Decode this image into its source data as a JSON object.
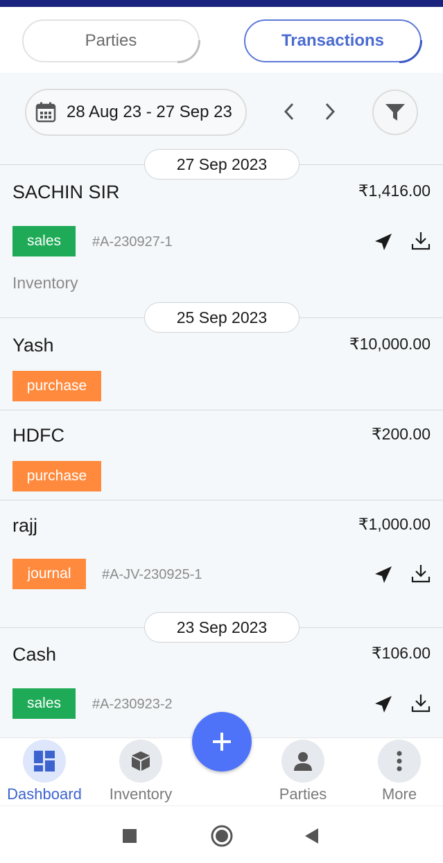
{
  "tabs": {
    "parties": "Parties",
    "transactions": "Transactions"
  },
  "filter": {
    "date_range": "28 Aug 23 - 27 Sep 23"
  },
  "groups": [
    {
      "date": "27 Sep 2023",
      "items": [
        {
          "name": "SACHIN SIR",
          "amount": "₹1,416.00",
          "type": "sales",
          "ref": "#A-230927-1",
          "sub": "Inventory"
        }
      ]
    },
    {
      "date": "25 Sep 2023",
      "items": [
        {
          "name": "Yash",
          "amount": "₹10,000.00",
          "type": "purchase"
        },
        {
          "name": "HDFC",
          "amount": "₹200.00",
          "type": "purchase"
        },
        {
          "name": "rajj",
          "amount": "₹1,000.00",
          "type": "journal",
          "ref": "#A-JV-230925-1"
        }
      ]
    },
    {
      "date": "23 Sep 2023",
      "items": [
        {
          "name": "Cash",
          "amount": "₹106.00",
          "type": "sales",
          "ref": "#A-230923-2"
        }
      ]
    }
  ],
  "bottom_nav": {
    "dashboard": "Dashboard",
    "inventory": "Inventory",
    "parties": "Parties",
    "more": "More"
  },
  "icons": {
    "calendar": "calendar-icon",
    "prev": "chevron-left-icon",
    "next": "chevron-right-icon",
    "filter": "filter-icon",
    "send": "send-icon",
    "download": "download-icon",
    "add": "plus-icon"
  },
  "colors": {
    "accent": "#4e73f8",
    "sales": "#1faa57",
    "purchase": "#ff8a3d",
    "status_bar": "#1a237e"
  }
}
